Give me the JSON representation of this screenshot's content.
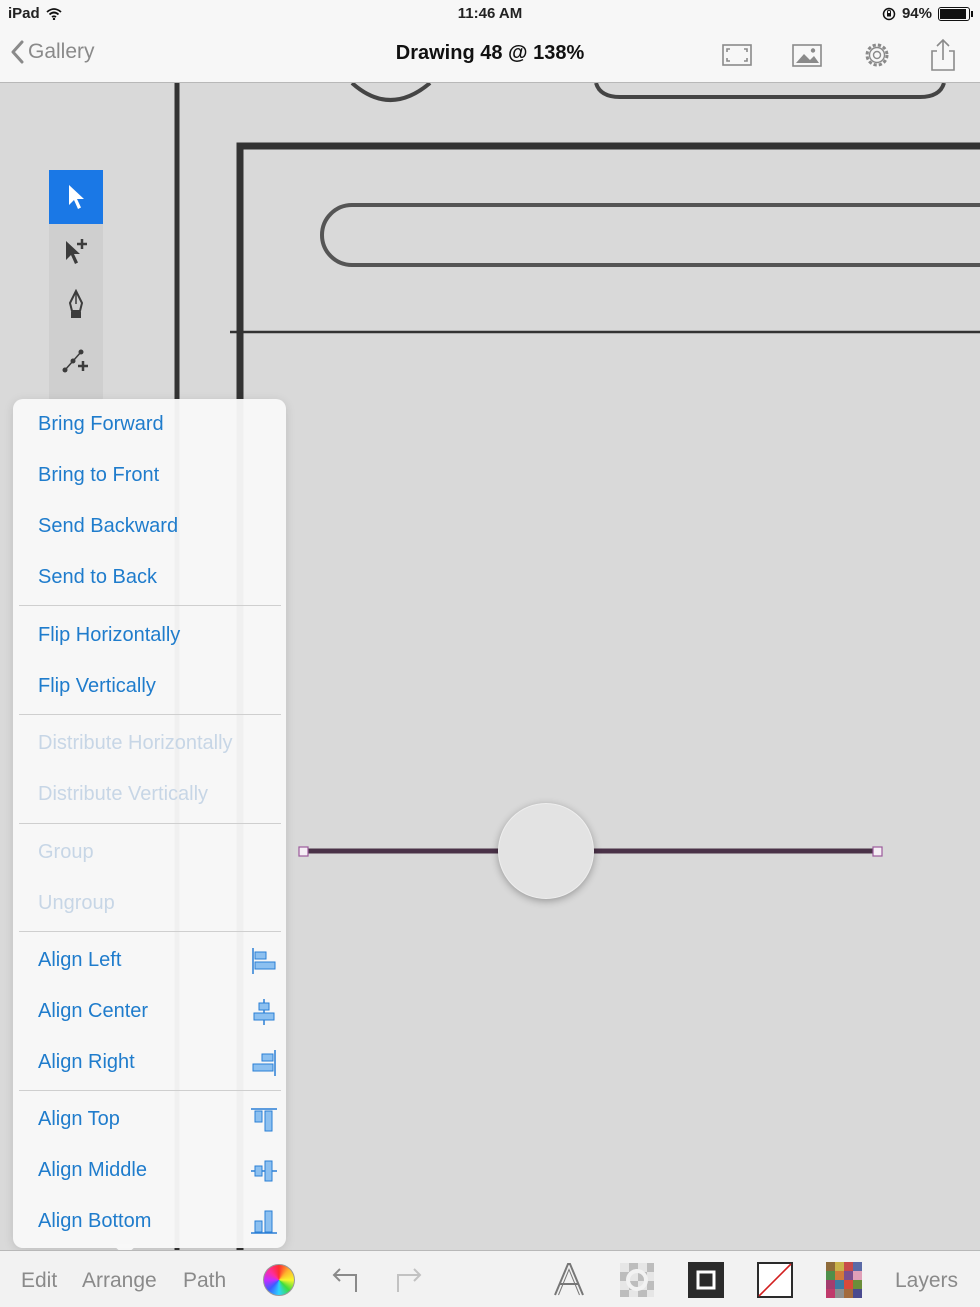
{
  "status_bar": {
    "device": "iPad",
    "time": "11:46 AM",
    "battery": "94%",
    "battery_level": 0.94
  },
  "nav": {
    "back_label": "Gallery",
    "title": "Drawing 48 @ 138%",
    "icons": [
      "fullscreen-icon",
      "image-icon",
      "settings-gear-icon",
      "share-icon"
    ]
  },
  "tools": [
    "select-arrow-icon",
    "subselect-arrow-icon",
    "pen-icon",
    "bezier-path-icon"
  ],
  "arrange_menu": {
    "groups": [
      {
        "items": [
          {
            "label": "Bring Forward",
            "enabled": true
          },
          {
            "label": "Bring to Front",
            "enabled": true
          },
          {
            "label": "Send Backward",
            "enabled": true
          },
          {
            "label": "Send to Back",
            "enabled": true
          }
        ]
      },
      {
        "items": [
          {
            "label": "Flip Horizontally",
            "enabled": true
          },
          {
            "label": "Flip Vertically",
            "enabled": true
          }
        ]
      },
      {
        "items": [
          {
            "label": "Distribute Horizontally",
            "enabled": false
          },
          {
            "label": "Distribute Vertically",
            "enabled": false
          }
        ]
      },
      {
        "items": [
          {
            "label": "Group",
            "enabled": false
          },
          {
            "label": "Ungroup",
            "enabled": false
          }
        ]
      },
      {
        "items": [
          {
            "label": "Align Left",
            "enabled": true,
            "icon": "align-left-icon"
          },
          {
            "label": "Align Center",
            "enabled": true,
            "icon": "align-center-icon"
          },
          {
            "label": "Align Right",
            "enabled": true,
            "icon": "align-right-icon"
          }
        ]
      },
      {
        "items": [
          {
            "label": "Align Top",
            "enabled": true,
            "icon": "align-top-icon"
          },
          {
            "label": "Align Middle",
            "enabled": true,
            "icon": "align-middle-icon"
          },
          {
            "label": "Align Bottom",
            "enabled": true,
            "icon": "align-bottom-icon"
          }
        ]
      }
    ]
  },
  "toolbar": {
    "edit_label": "Edit",
    "arrange_label": "Arrange",
    "path_label": "Path",
    "layers_label": "Layers",
    "icons": [
      "color-wheel-icon",
      "undo-icon",
      "redo-icon",
      "text-icon",
      "effects-icon",
      "stroke-icon",
      "fill-none-icon",
      "swatches-icon"
    ]
  },
  "colors": {
    "accent": "#1a78e6",
    "menu_text": "#1f7ccc",
    "menu_text_disabled": "#c7d6e6",
    "toolbar_text": "#8a8a8a"
  }
}
